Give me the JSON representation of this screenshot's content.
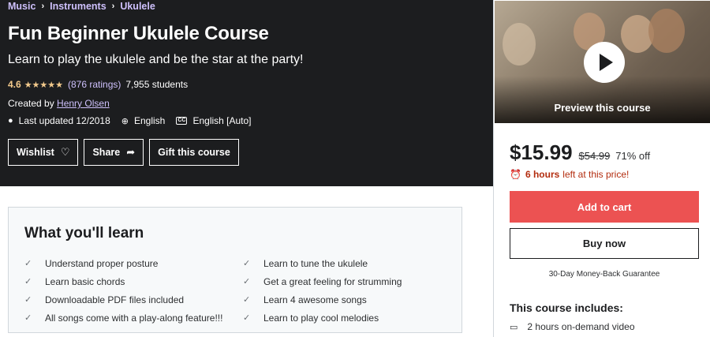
{
  "breadcrumb": [
    "Music",
    "Instruments",
    "Ukulele"
  ],
  "course": {
    "title": "Fun Beginner Ukulele Course",
    "subtitle": "Learn to play the ukulele and be the star at the party!",
    "rating": "4.6",
    "stars": "★★★★★",
    "ratings_count": "(876 ratings)",
    "students": "7,955 students",
    "created_by_label": "Created by",
    "instructor": "Henry Olsen",
    "last_updated": "Last updated 12/2018",
    "language": "English",
    "captions": "English [Auto]"
  },
  "actions": {
    "wishlist": "Wishlist",
    "share": "Share",
    "gift": "Gift this course"
  },
  "learn": {
    "title": "What you'll learn",
    "left": [
      "Understand proper posture",
      "Learn basic chords",
      "Downloadable PDF files included",
      "All songs come with a play-along feature!!!"
    ],
    "right": [
      "Learn to tune the ukulele",
      "Get a great feeling for strumming",
      "Learn 4 awesome songs",
      "Learn to play cool melodies"
    ]
  },
  "sidebar": {
    "preview_label": "Preview this course",
    "price": "$15.99",
    "old_price": "$54.99",
    "discount": "71% off",
    "timer_bold": "6 hours",
    "timer_rest": "left at this price!",
    "add_to_cart": "Add to cart",
    "buy_now": "Buy now",
    "guarantee": "30-Day Money-Back Guarantee",
    "includes_title": "This course includes:",
    "includes_items": [
      "2 hours on-demand video"
    ]
  },
  "colors": {
    "hero_bg": "#1c1d1f",
    "link_purple": "#cec0fc",
    "star": "#f3ca8c",
    "cta_red": "#ec5252",
    "timer_red": "#b32d0f"
  },
  "icons": {
    "breadcrumb_sep": "chevron-right-icon",
    "updated": "alert-circle-icon",
    "language": "globe-icon",
    "captions": "closed-captions-icon",
    "wishlist": "heart-icon",
    "share": "share-arrow-icon",
    "check": "check-icon",
    "timer": "alarm-clock-icon",
    "video": "video-icon",
    "play": "play-icon"
  }
}
